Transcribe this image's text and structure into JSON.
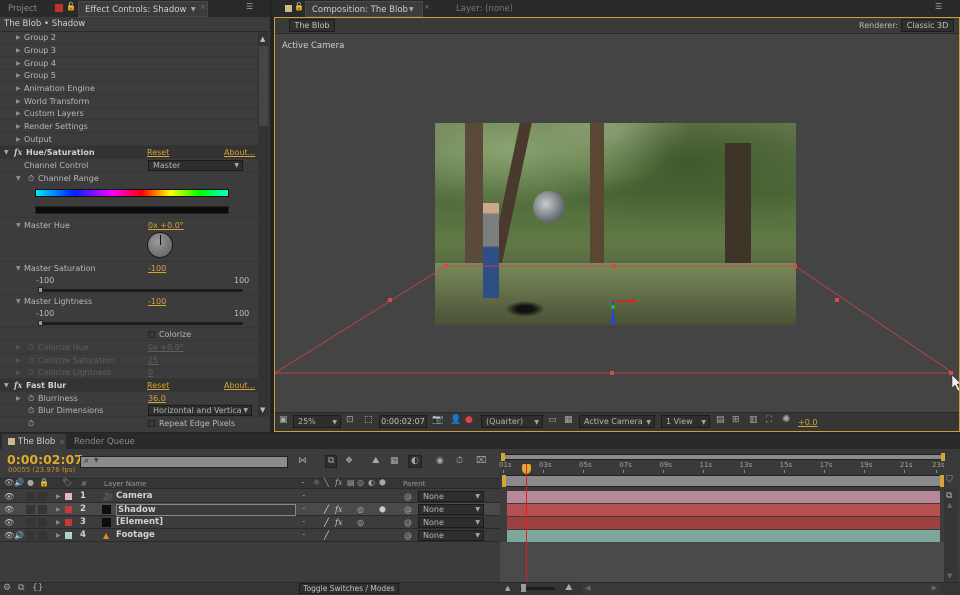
{
  "left_panel": {
    "tabs": [
      {
        "label": "Project"
      },
      {
        "label": "Effect Controls: Shadow"
      }
    ],
    "breadcrumb": "The Blob • Shadow",
    "groups": [
      "Group 2",
      "Group 3",
      "Group 4",
      "Group 5",
      "Animation Engine",
      "World Transform",
      "Custom Layers",
      "Render Settings",
      "Output"
    ],
    "hue_saturation": {
      "name": "Hue/Saturation",
      "reset": "Reset",
      "about": "About...",
      "channel_control_label": "Channel Control",
      "channel_control_value": "Master",
      "channel_range_label": "Channel Range",
      "master_hue_label": "Master Hue",
      "master_hue_value": "0x +0.0°",
      "master_saturation_label": "Master Saturation",
      "master_saturation_value": "-100",
      "saturation_min": "-100",
      "saturation_max": "100",
      "master_lightness_label": "Master Lightness",
      "master_lightness_value": "-100",
      "lightness_min": "-100",
      "lightness_max": "100",
      "colorize_label": "Colorize",
      "colorize_checked": false,
      "colorize_hue_label": "Colorize Hue",
      "colorize_hue_value": "0x +0.0°",
      "colorize_saturation_label": "Colorize Saturation",
      "colorize_saturation_value": "25",
      "colorize_lightness_label": "Colorize Lightness",
      "colorize_lightness_value": "0"
    },
    "fast_blur": {
      "name": "Fast Blur",
      "reset": "Reset",
      "about": "About...",
      "blurriness_label": "Blurriness",
      "blurriness_value": "36.0",
      "blur_dimensions_label": "Blur Dimensions",
      "blur_dimensions_value": "Horizontal and Vertica",
      "repeat_edge_label": "Repeat Edge Pixels",
      "repeat_edge_checked": false
    }
  },
  "composition_panel": {
    "tabs": [
      {
        "label": "Composition: The Blob"
      },
      {
        "label": "Layer: (none)"
      }
    ],
    "comp_button": "The Blob",
    "renderer_label": "Renderer:",
    "renderer_value": "Classic 3D",
    "view_label": "Active Camera",
    "footer": {
      "zoom": "25%",
      "timecode": "0:00:02:07",
      "resolution": "(Quarter)",
      "camera": "Active Camera",
      "views": "1 View",
      "exposure": "+0.0"
    }
  },
  "timeline": {
    "tabs": [
      {
        "label": "The Blob"
      },
      {
        "label": "Render Queue"
      }
    ],
    "current_time": "0:00:02:07",
    "frame_info": "00055 (23.976 fps)",
    "search_placeholder": "",
    "columns": {
      "number": "#",
      "layer_name": "Layer Name",
      "parent": "Parent"
    },
    "ruler_ticks": [
      "01s",
      "03s",
      "05s",
      "07s",
      "09s",
      "11s",
      "13s",
      "15s",
      "17s",
      "19s",
      "21s",
      "23s"
    ],
    "layers": [
      {
        "num": "1",
        "name": "Camera",
        "label_color": "#e2b4c4",
        "parent": "None",
        "bar_color": "#b7889a"
      },
      {
        "num": "2",
        "name": "Shadow",
        "label_color": "#c63a3a",
        "parent": "None",
        "bar_color": "#b55050"
      },
      {
        "num": "3",
        "name": "[Element]",
        "label_color": "#c63a3a",
        "parent": "None",
        "bar_color": "#9c4040"
      },
      {
        "num": "4",
        "name": "Footage",
        "label_color": "#a8d6c8",
        "parent": "None",
        "bar_color": "#7fa69b"
      }
    ],
    "toggle_label": "Toggle Switches / Modes"
  },
  "colors": {
    "accent": "#d6a536",
    "playhead": "#e02020",
    "camera_guide": "#c84646"
  }
}
